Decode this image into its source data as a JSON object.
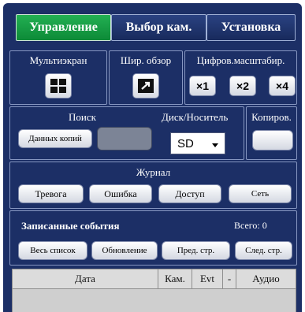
{
  "tabs": [
    {
      "label": "Управление",
      "active": true
    },
    {
      "label": "Выбор кам.",
      "active": false
    },
    {
      "label": "Установка",
      "active": false
    }
  ],
  "view": {
    "multiscreen_label": "Мультиэкран",
    "wide_label": "Шир. обзор",
    "zoom_label": "Цифров.масштабир.",
    "zoom_buttons": [
      "×1",
      "×2",
      "×4"
    ]
  },
  "search": {
    "label": "Поиск",
    "data_copy_button": "Данных копий",
    "disk_label": "Диск/Носитель",
    "disk_value": "SD",
    "copy_label": "Копиров."
  },
  "log": {
    "label": "Журнал",
    "buttons": [
      "Тревога",
      "Ошибка",
      "Доступ",
      "Сеть"
    ]
  },
  "events": {
    "title": "Записанные события",
    "total": "Всего: 0",
    "buttons": [
      "Весь список",
      "Обновление",
      "Пред. стр.",
      "След. стр."
    ],
    "columns": [
      "Дата",
      "Кам.",
      "Evt",
      "-",
      "Аудио"
    ]
  },
  "colors": {
    "panel_bg": "#1c2f66",
    "active_tab": "#13983f",
    "button_face": "#ffffff"
  }
}
